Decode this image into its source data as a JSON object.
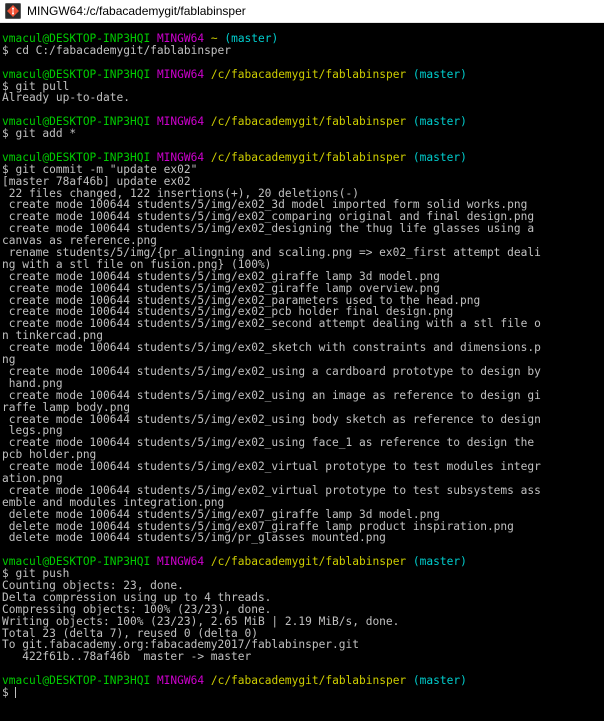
{
  "window": {
    "title": "MINGW64:/c/fabacademygit/fablabinsper"
  },
  "colors": {
    "user": "#00cd00",
    "host": "#cd00cd",
    "path": "#cdcd00",
    "branch": "#00cdcd",
    "text": "#c0c0c0",
    "background": "#000000"
  },
  "terminal": {
    "lines": [
      {
        "type": "prompt",
        "user": "vmacul@DESKTOP-INP3HQI",
        "host": "MINGW64",
        "path": "~",
        "branch": "(master)"
      },
      {
        "type": "text",
        "text": "$ cd C:/fabacademygit/fablabinsper"
      },
      {
        "type": "blank"
      },
      {
        "type": "prompt",
        "user": "vmacul@DESKTOP-INP3HQI",
        "host": "MINGW64",
        "path": "/c/fabacademygit/fablabinsper",
        "branch": "(master)"
      },
      {
        "type": "text",
        "text": "$ git pull"
      },
      {
        "type": "text",
        "text": "Already up-to-date."
      },
      {
        "type": "blank"
      },
      {
        "type": "prompt",
        "user": "vmacul@DESKTOP-INP3HQI",
        "host": "MINGW64",
        "path": "/c/fabacademygit/fablabinsper",
        "branch": "(master)"
      },
      {
        "type": "text",
        "text": "$ git add *"
      },
      {
        "type": "blank"
      },
      {
        "type": "prompt",
        "user": "vmacul@DESKTOP-INP3HQI",
        "host": "MINGW64",
        "path": "/c/fabacademygit/fablabinsper",
        "branch": "(master)"
      },
      {
        "type": "text",
        "text": "$ git commit -m \"update ex02\""
      },
      {
        "type": "text",
        "text": "[master 78af46b] update ex02"
      },
      {
        "type": "text",
        "text": " 22 files changed, 122 insertions(+), 20 deletions(-)"
      },
      {
        "type": "text",
        "text": " create mode 100644 students/5/img/ex02_3d model imported form solid works.png"
      },
      {
        "type": "text",
        "text": " create mode 100644 students/5/img/ex02_comparing original and final design.png"
      },
      {
        "type": "text",
        "text": " create mode 100644 students/5/img/ex02_designing the thug life glasses using a"
      },
      {
        "type": "text",
        "text": "canvas as reference.png"
      },
      {
        "type": "text",
        "text": " rename students/5/img/{pr_alingning and scaling.png => ex02_first attempt deali"
      },
      {
        "type": "text",
        "text": "ng with a stl file on fusion.png} (100%)"
      },
      {
        "type": "text",
        "text": " create mode 100644 students/5/img/ex02_giraffe lamp 3d model.png"
      },
      {
        "type": "text",
        "text": " create mode 100644 students/5/img/ex02_giraffe lamp overview.png"
      },
      {
        "type": "text",
        "text": " create mode 100644 students/5/img/ex02_parameters used to the head.png"
      },
      {
        "type": "text",
        "text": " create mode 100644 students/5/img/ex02_pcb holder final design.png"
      },
      {
        "type": "text",
        "text": " create mode 100644 students/5/img/ex02_second attempt dealing with a stl file o"
      },
      {
        "type": "text",
        "text": "n tinkercad.png"
      },
      {
        "type": "text",
        "text": " create mode 100644 students/5/img/ex02_sketch with constraints and dimensions.p"
      },
      {
        "type": "text",
        "text": "ng"
      },
      {
        "type": "text",
        "text": " create mode 100644 students/5/img/ex02_using a cardboard prototype to design by"
      },
      {
        "type": "text",
        "text": " hand.png"
      },
      {
        "type": "text",
        "text": " create mode 100644 students/5/img/ex02_using an image as reference to design gi"
      },
      {
        "type": "text",
        "text": "raffe lamp body.png"
      },
      {
        "type": "text",
        "text": " create mode 100644 students/5/img/ex02_using body sketch as reference to design"
      },
      {
        "type": "text",
        "text": " legs.png"
      },
      {
        "type": "text",
        "text": " create mode 100644 students/5/img/ex02_using face_1 as reference to design the"
      },
      {
        "type": "text",
        "text": "pcb holder.png"
      },
      {
        "type": "text",
        "text": " create mode 100644 students/5/img/ex02_virtual prototype to test modules integr"
      },
      {
        "type": "text",
        "text": "ation.png"
      },
      {
        "type": "text",
        "text": " create mode 100644 students/5/img/ex02_virtual prototype to test subsystems ass"
      },
      {
        "type": "text",
        "text": "emble and modules integration.png"
      },
      {
        "type": "text",
        "text": " delete mode 100644 students/5/img/ex07_giraffe lamp 3d model.png"
      },
      {
        "type": "text",
        "text": " delete mode 100644 students/5/img/ex07_giraffe lamp product inspiration.png"
      },
      {
        "type": "text",
        "text": " delete mode 100644 students/5/img/pr_glasses mounted.png"
      },
      {
        "type": "blank"
      },
      {
        "type": "prompt",
        "user": "vmacul@DESKTOP-INP3HQI",
        "host": "MINGW64",
        "path": "/c/fabacademygit/fablabinsper",
        "branch": "(master)"
      },
      {
        "type": "text",
        "text": "$ git push"
      },
      {
        "type": "text",
        "text": "Counting objects: 23, done."
      },
      {
        "type": "text",
        "text": "Delta compression using up to 4 threads."
      },
      {
        "type": "text",
        "text": "Compressing objects: 100% (23/23), done."
      },
      {
        "type": "text",
        "text": "Writing objects: 100% (23/23), 2.65 MiB | 2.19 MiB/s, done."
      },
      {
        "type": "text",
        "text": "Total 23 (delta 7), reused 0 (delta 0)"
      },
      {
        "type": "text",
        "text": "To git.fabacademy.org:fabacademy2017/fablabinsper.git"
      },
      {
        "type": "text",
        "text": "   422f61b..78af46b  master -> master"
      },
      {
        "type": "blank"
      },
      {
        "type": "prompt",
        "user": "vmacul@DESKTOP-INP3HQI",
        "host": "MINGW64",
        "path": "/c/fabacademygit/fablabinsper",
        "branch": "(master)"
      },
      {
        "type": "input",
        "text": "$ "
      }
    ]
  }
}
